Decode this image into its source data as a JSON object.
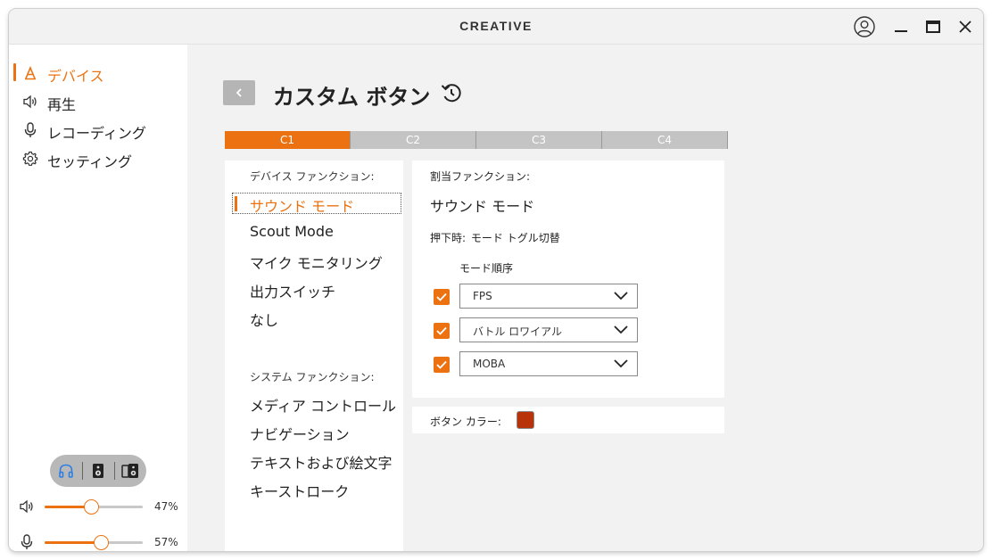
{
  "app": {
    "logo": "CREATIVE"
  },
  "sidebar": {
    "items": [
      {
        "label": "デバイス",
        "icon": "device-icon",
        "active": true
      },
      {
        "label": "再生",
        "icon": "speaker-icon",
        "active": false
      },
      {
        "label": "レコーディング",
        "icon": "microphone-icon",
        "active": false
      },
      {
        "label": "セッティング",
        "icon": "gear-icon",
        "active": false
      }
    ],
    "output_toggle": [
      "headphones-icon",
      "speaker-box-icon",
      "dual-speaker-icon"
    ],
    "volume": {
      "percent_label": "47%",
      "value": 0.47
    },
    "mic": {
      "percent_label": "57%",
      "value": 0.57
    }
  },
  "main": {
    "title": "カスタム ボタン",
    "tabs": [
      {
        "label": "C1",
        "active": true
      },
      {
        "label": "C2",
        "active": false
      },
      {
        "label": "C3",
        "active": false
      },
      {
        "label": "C4",
        "active": false
      }
    ],
    "device_functions_heading": "デバイス ファンクション:",
    "device_functions": [
      "サウンド モード",
      "Scout Mode",
      "マイク モニタリング",
      "出力スイッチ",
      "なし"
    ],
    "system_functions_heading": "システム ファンクション:",
    "system_functions": [
      "メディア コントロール",
      "ナビゲーション",
      "テキストおよび絵文字",
      "キーストローク"
    ],
    "assigned": {
      "heading": "割当ファンクション:",
      "value": "サウンド モード",
      "press_label": "押下時:",
      "press_value": "モード トグル切替",
      "mode_order_label": "モード順序",
      "modes": [
        {
          "value": "FPS",
          "checked": true
        },
        {
          "value": "バトル ロワイアル",
          "checked": true
        },
        {
          "value": "MOBA",
          "checked": true
        }
      ]
    },
    "button_color": {
      "label": "ボタン カラー:",
      "value": "#b8320a"
    }
  },
  "colors": {
    "accent": "#ec7211"
  }
}
